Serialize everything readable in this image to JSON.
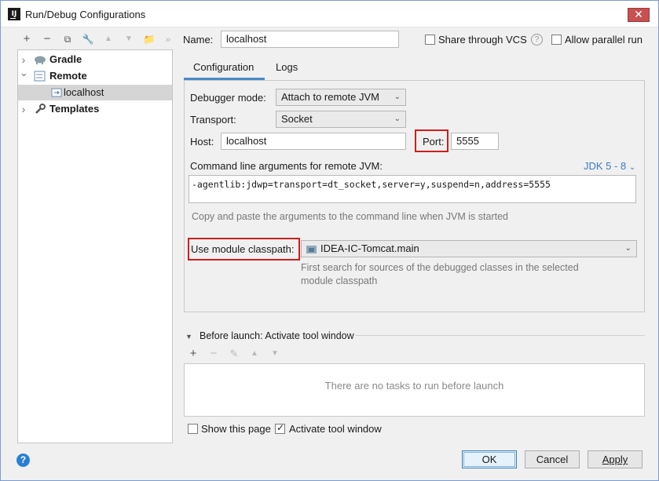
{
  "window": {
    "title": "Run/Debug Configurations",
    "app_icon": "IJ",
    "close_glyph": "✕"
  },
  "toolbar": {
    "add": "+",
    "remove": "−",
    "copy": "⧉",
    "edit_defaults": "🔧",
    "move_up": "▲",
    "move_down": "▼",
    "folder": "📁",
    "more": "»",
    "icons": [
      "plus-icon",
      "minus-icon",
      "copy-icon",
      "wrench-icon",
      "arrow-up-icon",
      "arrow-down-icon",
      "folder-icon",
      "double-chevron-icon"
    ]
  },
  "tree": {
    "gradle": "Gradle",
    "remote": "Remote",
    "localhost": "localhost",
    "templates": "Templates",
    "collapsed_arrow": "›",
    "expanded_arrow": "⌄"
  },
  "name_field": {
    "label": "Name:",
    "value": "localhost"
  },
  "share_vcs": {
    "label": "Share through VCS",
    "checked": false
  },
  "allow_parallel": {
    "label": "Allow parallel run",
    "checked": false
  },
  "tabs": {
    "configuration": "Configuration",
    "logs": "Logs"
  },
  "config": {
    "debugger_mode_label": "Debugger mode:",
    "debugger_mode_value": "Attach to remote JVM",
    "transport_label": "Transport:",
    "transport_value": "Socket",
    "host_label": "Host:",
    "host_value": "localhost",
    "port_label": "Port:",
    "port_value": "5555",
    "cmdline_label": "Command line arguments for remote JVM:",
    "jdk_selector": "JDK 5 - 8",
    "cmdline_value": "-agentlib:jdwp=transport=dt_socket,server=y,suspend=n,address=5555",
    "cmdline_hint": "Copy and paste the arguments to the command line when JVM is started",
    "module_label": "Use module classpath:",
    "module_value": "IDEA-IC-Tomcat.main",
    "module_hint_line1": "First search for sources of the debugged classes in the selected",
    "module_hint_line2": "module classpath"
  },
  "before_launch": {
    "label": "Before launch: Activate tool window",
    "empty_text": "There are no tasks to run before launch",
    "add": "+",
    "remove": "−",
    "edit": "✎",
    "up": "▲",
    "down": "▼"
  },
  "footer": {
    "show_page": {
      "label": "Show this page",
      "checked": false
    },
    "activate_tool_window": {
      "label": "Activate tool window",
      "checked": true
    },
    "help": "?",
    "ok": "OK",
    "cancel": "Cancel",
    "apply": "Apply"
  },
  "colors": {
    "highlight_red": "#cc1f1f",
    "tab_accent": "#4a88c7",
    "link_blue": "#3d79c2",
    "help_blue": "#2a7fd4"
  }
}
